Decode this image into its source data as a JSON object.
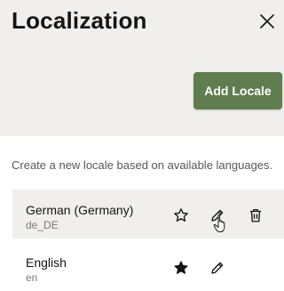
{
  "dialog": {
    "title": "Localization",
    "close_icon": "close-icon"
  },
  "toolbar": {
    "add_label": "Add Locale",
    "accent_color": "#5f7d4f"
  },
  "description": "Create a new locale based on available languages.",
  "locales": [
    {
      "name": "German (Germany)",
      "code": "de_DE",
      "default": false,
      "icons": [
        "star-outline-icon",
        "pencil-icon",
        "trash-icon"
      ]
    },
    {
      "name": "English",
      "code": "en",
      "default": true,
      "icons": [
        "star-filled-icon",
        "pencil-icon"
      ]
    }
  ]
}
